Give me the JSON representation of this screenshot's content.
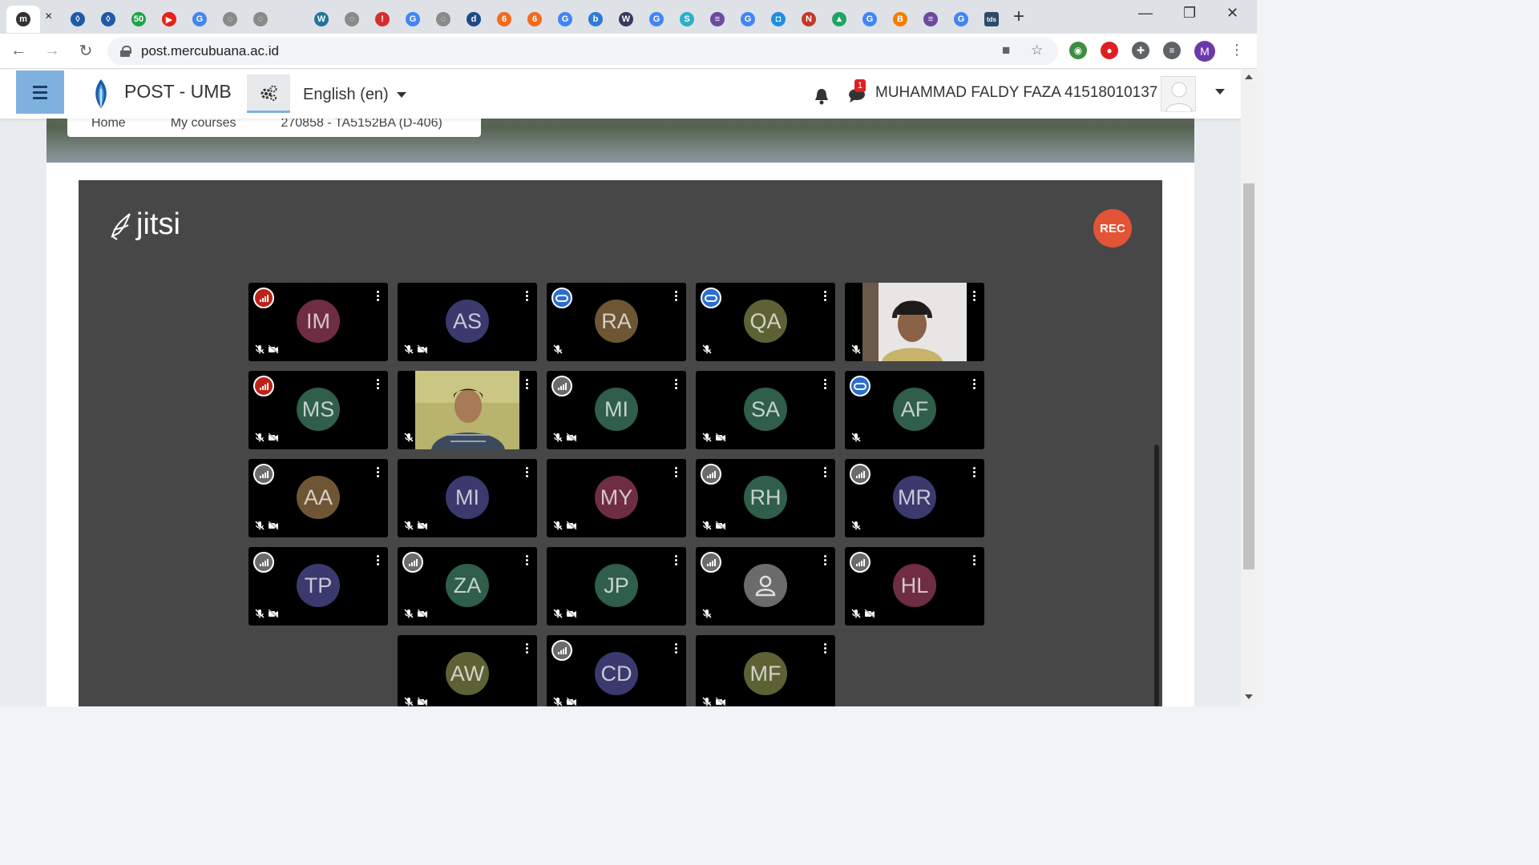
{
  "browser": {
    "url": "post.mercubuana.ac.id",
    "profile_initial": "M",
    "window_controls": [
      "minimize-icon",
      "restore-icon",
      "close-icon"
    ]
  },
  "moodle": {
    "brand": "POST - UMB",
    "language": "English (en)",
    "notification_count": "1",
    "user_name": "MUHAMMAD FALDY FAZA 41518010137",
    "breadcrumb": [
      "Home",
      "My courses",
      "270858 - TA5152BA (D-406)"
    ]
  },
  "jitsi": {
    "logo_text": "jitsi",
    "rec_label": "REC",
    "participants": [
      {
        "initials": "IM",
        "color": "#6e2d43",
        "conn": "red",
        "muted": true,
        "video_off": true,
        "row": 0,
        "col": 0
      },
      {
        "initials": "AS",
        "color": "#3a3a6e",
        "conn": "none",
        "muted": true,
        "video_off": true,
        "row": 0,
        "col": 1
      },
      {
        "initials": "RA",
        "color": "#6e5534",
        "conn": "blue",
        "muted": true,
        "video_off": false,
        "row": 0,
        "col": 2
      },
      {
        "initials": "QA",
        "color": "#5c6233",
        "conn": "blue",
        "muted": true,
        "video_off": false,
        "row": 0,
        "col": 3
      },
      {
        "initials": "",
        "color": "#000000",
        "conn": "none",
        "muted": true,
        "video_off": false,
        "video": "female",
        "row": 0,
        "col": 4
      },
      {
        "initials": "MS",
        "color": "#2f5e4a",
        "conn": "red",
        "muted": true,
        "video_off": true,
        "row": 1,
        "col": 0
      },
      {
        "initials": "",
        "color": "#000000",
        "conn": "none",
        "muted": true,
        "video_off": false,
        "video": "male",
        "row": 1,
        "col": 1
      },
      {
        "initials": "MI",
        "color": "#2f5e4a",
        "conn": "grey",
        "muted": true,
        "video_off": true,
        "row": 1,
        "col": 2
      },
      {
        "initials": "SA",
        "color": "#2f5e4a",
        "conn": "none",
        "muted": true,
        "video_off": true,
        "row": 1,
        "col": 3
      },
      {
        "initials": "AF",
        "color": "#2f5e4a",
        "conn": "blue",
        "muted": true,
        "video_off": false,
        "row": 1,
        "col": 4
      },
      {
        "initials": "AA",
        "color": "#6e5534",
        "conn": "grey",
        "muted": true,
        "video_off": true,
        "row": 2,
        "col": 0
      },
      {
        "initials": "MI",
        "color": "#3a3a6e",
        "conn": "none",
        "muted": true,
        "video_off": true,
        "row": 2,
        "col": 1
      },
      {
        "initials": "MY",
        "color": "#6e2d43",
        "conn": "none",
        "muted": true,
        "video_off": true,
        "row": 2,
        "col": 2
      },
      {
        "initials": "RH",
        "color": "#2f5e4a",
        "conn": "grey",
        "muted": true,
        "video_off": true,
        "row": 2,
        "col": 3
      },
      {
        "initials": "MR",
        "color": "#3a3a6e",
        "conn": "grey",
        "muted": true,
        "video_off": false,
        "row": 2,
        "col": 4
      },
      {
        "initials": "TP",
        "color": "#3a3a6e",
        "conn": "grey",
        "muted": true,
        "video_off": true,
        "row": 3,
        "col": 0
      },
      {
        "initials": "ZA",
        "color": "#2f5e4a",
        "conn": "grey",
        "muted": true,
        "video_off": true,
        "row": 3,
        "col": 1
      },
      {
        "initials": "JP",
        "color": "#2f5e4a",
        "conn": "none",
        "muted": true,
        "video_off": true,
        "row": 3,
        "col": 2
      },
      {
        "initials": "",
        "color": "#6b6b6b",
        "conn": "grey",
        "muted": true,
        "video_off": false,
        "generic": true,
        "row": 3,
        "col": 3
      },
      {
        "initials": "HL",
        "color": "#6e2d43",
        "conn": "grey",
        "muted": true,
        "video_off": true,
        "row": 3,
        "col": 4
      },
      {
        "initials": "AW",
        "color": "#5c6233",
        "conn": "none",
        "muted": true,
        "video_off": true,
        "row": 4,
        "col": 1
      },
      {
        "initials": "CD",
        "color": "#3a3a6e",
        "conn": "grey",
        "muted": true,
        "video_off": true,
        "row": 4,
        "col": 2
      },
      {
        "initials": "MF",
        "color": "#5c6233",
        "conn": "none",
        "muted": true,
        "video_off": true,
        "row": 4,
        "col": 3
      }
    ]
  },
  "tabs": [
    {
      "icon": "moodle-m-icon",
      "bg": "#333333",
      "glyph": "m"
    },
    {
      "icon": "close-icon",
      "bg": "#ffffff",
      "glyph": "×"
    },
    {
      "icon": "umb-flame-icon",
      "bg": "#1e5aa8",
      "glyph": "◊"
    },
    {
      "icon": "umb-flame-icon",
      "bg": "#1e5aa8",
      "glyph": "◊"
    },
    {
      "icon": "whatsapp-50-icon",
      "bg": "#1fa34a",
      "glyph": "50"
    },
    {
      "icon": "youtube-icon",
      "bg": "#e62117",
      "glyph": "▶"
    },
    {
      "icon": "google-icon",
      "bg": "#4285f4",
      "glyph": "G"
    },
    {
      "icon": "globe-icon",
      "bg": "#8a8a8a",
      "glyph": "◌"
    },
    {
      "icon": "globe-icon",
      "bg": "#8a8a8a",
      "glyph": "◌"
    },
    {
      "icon": "blank-icon",
      "bg": "#dee1e6",
      "glyph": ""
    },
    {
      "icon": "wordpress-icon",
      "bg": "#21759b",
      "glyph": "W"
    },
    {
      "icon": "globe-icon",
      "bg": "#8a8a8a",
      "glyph": "◌"
    },
    {
      "icon": "pin-icon",
      "bg": "#d32f2f",
      "glyph": "!"
    },
    {
      "icon": "google-icon",
      "bg": "#4285f4",
      "glyph": "G"
    },
    {
      "icon": "globe-icon",
      "bg": "#8a8a8a",
      "glyph": "◌"
    },
    {
      "icon": "detik-icon",
      "bg": "#1e4a8a",
      "glyph": "d"
    },
    {
      "icon": "six-icon",
      "bg": "#f26b1d",
      "glyph": "6"
    },
    {
      "icon": "six-icon",
      "bg": "#f26b1d",
      "glyph": "6"
    },
    {
      "icon": "google-icon",
      "bg": "#4285f4",
      "glyph": "G"
    },
    {
      "icon": "b-icon",
      "bg": "#2f7bd6",
      "glyph": "b"
    },
    {
      "icon": "wp-icon",
      "bg": "#333a5c",
      "glyph": "W"
    },
    {
      "icon": "google-icon",
      "bg": "#4285f4",
      "glyph": "G"
    },
    {
      "icon": "s-icon",
      "bg": "#2bb0c8",
      "glyph": "S"
    },
    {
      "icon": "bookstack-icon",
      "bg": "#6b4aa0",
      "glyph": "≡"
    },
    {
      "icon": "google-icon",
      "bg": "#4285f4",
      "glyph": "G"
    },
    {
      "icon": "chat-icon",
      "bg": "#1e8fe0",
      "glyph": "◘"
    },
    {
      "icon": "news-icon",
      "bg": "#c0392b",
      "glyph": "N"
    },
    {
      "icon": "drive-icon",
      "bg": "#1fa463",
      "glyph": "▲"
    },
    {
      "icon": "google-icon",
      "bg": "#4285f4",
      "glyph": "G"
    },
    {
      "icon": "blogger-icon",
      "bg": "#f57d00",
      "glyph": "B"
    },
    {
      "icon": "bookstack-icon",
      "bg": "#6b4aa0",
      "glyph": "≡"
    },
    {
      "icon": "google-icon",
      "bg": "#4285f4",
      "glyph": "G"
    },
    {
      "icon": "tds-icon",
      "bg": "#2e4a6b",
      "glyph": "tds"
    }
  ],
  "extensions": [
    {
      "icon": "earth-extension-icon",
      "bg": "#3b8f3e",
      "glyph": "◉"
    },
    {
      "icon": "stop-extension-icon",
      "bg": "#e02020",
      "glyph": "●"
    },
    {
      "icon": "puzzle-extension-icon",
      "bg": "#5f6368",
      "glyph": "✚"
    },
    {
      "icon": "media-extension-icon",
      "bg": "#5f6368",
      "glyph": "≡"
    }
  ]
}
